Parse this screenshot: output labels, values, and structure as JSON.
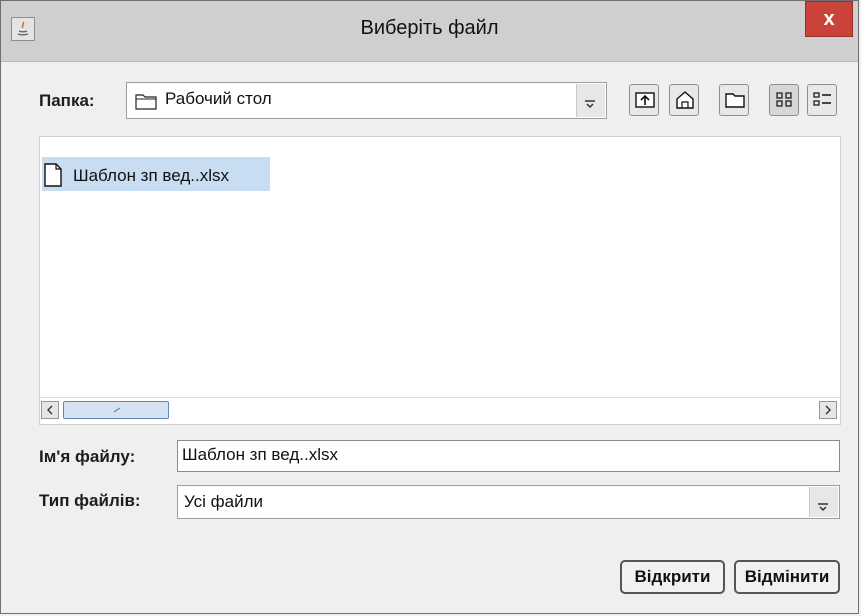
{
  "window": {
    "title": "Виберіть файл",
    "close_label": "x"
  },
  "folder": {
    "label": "Папка:",
    "value": "Рабочий стол"
  },
  "file_list": {
    "items": [
      {
        "name": "Шаблон зп вед..xlsx",
        "icon": "file-icon",
        "selected": true
      }
    ]
  },
  "file_name": {
    "label": "Ім'я файлу:",
    "value": "Шаблон зп вед..xlsx"
  },
  "file_type": {
    "label": "Тип файлів:",
    "value": "Усі файли"
  },
  "buttons": {
    "open": "Відкрити",
    "cancel": "Відмінити"
  },
  "colors": {
    "selection": "#c8dcf2",
    "close": "#c9433a"
  },
  "toolbar_icons": [
    "up-one-level-icon",
    "home-icon",
    "new-folder-icon",
    "list-view-icon",
    "details-view-icon"
  ]
}
